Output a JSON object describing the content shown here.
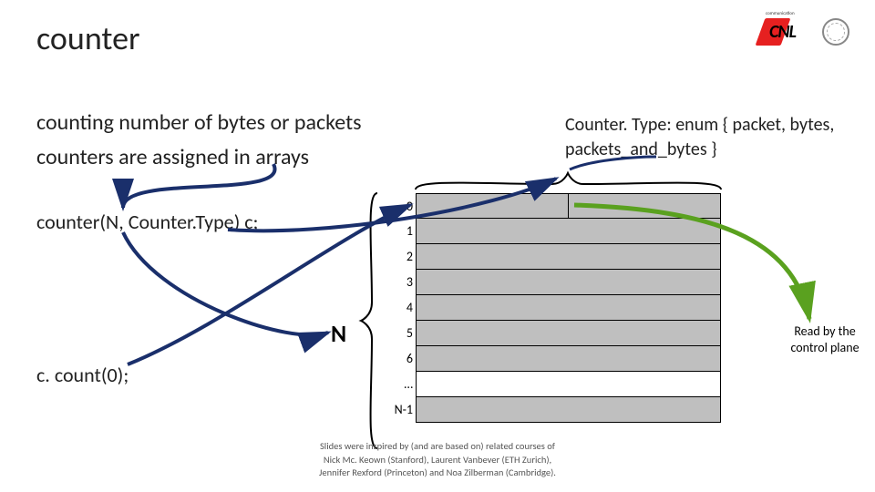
{
  "title": "counter",
  "subtitle1": "counting number of bytes or packets",
  "subtitle2": "counters are assigned in arrays",
  "enum_text": "Counter. Type: enum { packet, bytes, packets_and_bytes }",
  "declaration": "counter(N, Counter.Type) c;",
  "count_call": "c. count(0);",
  "n_label": "N",
  "read_label": "Read by the control plane",
  "array": {
    "labels": [
      "0",
      "1",
      "2",
      "3",
      "4",
      "5",
      "6",
      "…",
      "N-1"
    ]
  },
  "footer": {
    "line1": "Slides were inspired by (and are based on) related courses of",
    "line2": "Nick Mc. Keown (Stanford), Laurent Vanbever (ETH Zurich),",
    "line3": "Jennifer Rexford (Princeton) and Noa Zilberman (Cambridge)."
  },
  "logos": {
    "cnl_super": "communication",
    "cnl_main": "CNL"
  }
}
